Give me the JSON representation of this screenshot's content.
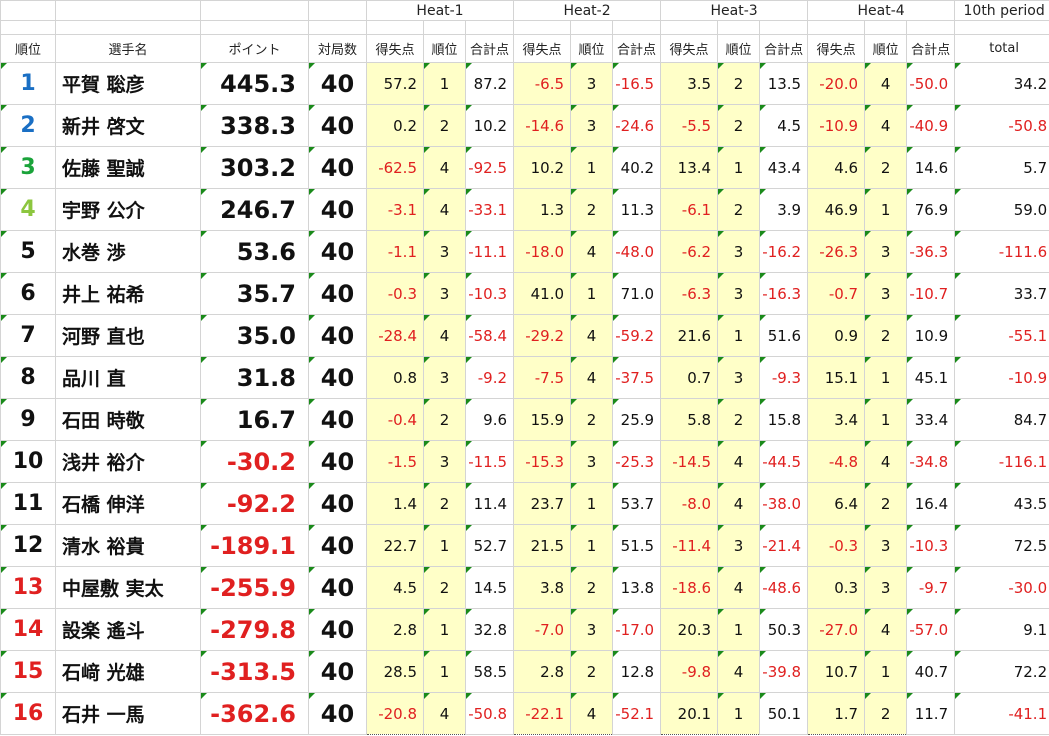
{
  "header": {
    "heats": [
      "Heat-1",
      "Heat-2",
      "Heat-3",
      "Heat-4"
    ],
    "period": "10th period",
    "col_rank": "順位",
    "col_name": "選手名",
    "col_points": "ポイント",
    "col_games": "対局数",
    "col_score": "得失点",
    "col_place": "順位",
    "col_cum": "合計点",
    "col_total": "total"
  },
  "colors": {
    "rank1": "#1a6fc4",
    "rank2": "#1a6fc4",
    "rank3": "#1aa33a",
    "rank4": "#8cc63f",
    "default": "#111111",
    "negative": "#e02020",
    "highlight": "#ffffc8"
  },
  "rows": [
    {
      "rank": "1",
      "name": "平賀 聡彦",
      "points": "445.3",
      "games": "40",
      "h": [
        [
          "57.2",
          "1",
          "87.2"
        ],
        [
          "-6.5",
          "3",
          "-16.5"
        ],
        [
          "3.5",
          "2",
          "13.5"
        ],
        [
          "-20.0",
          "4",
          "-50.0"
        ]
      ],
      "total": "34.2"
    },
    {
      "rank": "2",
      "name": "新井 啓文",
      "points": "338.3",
      "games": "40",
      "h": [
        [
          "0.2",
          "2",
          "10.2"
        ],
        [
          "-14.6",
          "3",
          "-24.6"
        ],
        [
          "-5.5",
          "2",
          "4.5"
        ],
        [
          "-10.9",
          "4",
          "-40.9"
        ]
      ],
      "total": "-50.8"
    },
    {
      "rank": "3",
      "name": "佐藤 聖誠",
      "points": "303.2",
      "games": "40",
      "h": [
        [
          "-62.5",
          "4",
          "-92.5"
        ],
        [
          "10.2",
          "1",
          "40.2"
        ],
        [
          "13.4",
          "1",
          "43.4"
        ],
        [
          "4.6",
          "2",
          "14.6"
        ]
      ],
      "total": "5.7"
    },
    {
      "rank": "4",
      "name": "宇野 公介",
      "points": "246.7",
      "games": "40",
      "h": [
        [
          "-3.1",
          "4",
          "-33.1"
        ],
        [
          "1.3",
          "2",
          "11.3"
        ],
        [
          "-6.1",
          "2",
          "3.9"
        ],
        [
          "46.9",
          "1",
          "76.9"
        ]
      ],
      "total": "59.0"
    },
    {
      "rank": "5",
      "name": "水巻 渉",
      "points": "53.6",
      "games": "40",
      "h": [
        [
          "-1.1",
          "3",
          "-11.1"
        ],
        [
          "-18.0",
          "4",
          "-48.0"
        ],
        [
          "-6.2",
          "3",
          "-16.2"
        ],
        [
          "-26.3",
          "3",
          "-36.3"
        ]
      ],
      "total": "-111.6"
    },
    {
      "rank": "6",
      "name": "井上 祐希",
      "points": "35.7",
      "games": "40",
      "h": [
        [
          "-0.3",
          "3",
          "-10.3"
        ],
        [
          "41.0",
          "1",
          "71.0"
        ],
        [
          "-6.3",
          "3",
          "-16.3"
        ],
        [
          "-0.7",
          "3",
          "-10.7"
        ]
      ],
      "total": "33.7"
    },
    {
      "rank": "7",
      "name": "河野 直也",
      "points": "35.0",
      "games": "40",
      "h": [
        [
          "-28.4",
          "4",
          "-58.4"
        ],
        [
          "-29.2",
          "4",
          "-59.2"
        ],
        [
          "21.6",
          "1",
          "51.6"
        ],
        [
          "0.9",
          "2",
          "10.9"
        ]
      ],
      "total": "-55.1"
    },
    {
      "rank": "8",
      "name": "品川 直",
      "points": "31.8",
      "games": "40",
      "h": [
        [
          "0.8",
          "3",
          "-9.2"
        ],
        [
          "-7.5",
          "4",
          "-37.5"
        ],
        [
          "0.7",
          "3",
          "-9.3"
        ],
        [
          "15.1",
          "1",
          "45.1"
        ]
      ],
      "total": "-10.9"
    },
    {
      "rank": "9",
      "name": "石田 時敬",
      "points": "16.7",
      "games": "40",
      "h": [
        [
          "-0.4",
          "2",
          "9.6"
        ],
        [
          "15.9",
          "2",
          "25.9"
        ],
        [
          "5.8",
          "2",
          "15.8"
        ],
        [
          "3.4",
          "1",
          "33.4"
        ]
      ],
      "total": "84.7"
    },
    {
      "rank": "10",
      "name": "浅井 裕介",
      "points": "-30.2",
      "games": "40",
      "h": [
        [
          "-1.5",
          "3",
          "-11.5"
        ],
        [
          "-15.3",
          "3",
          "-25.3"
        ],
        [
          "-14.5",
          "4",
          "-44.5"
        ],
        [
          "-4.8",
          "4",
          "-34.8"
        ]
      ],
      "total": "-116.1"
    },
    {
      "rank": "11",
      "name": "石橋 伸洋",
      "points": "-92.2",
      "games": "40",
      "h": [
        [
          "1.4",
          "2",
          "11.4"
        ],
        [
          "23.7",
          "1",
          "53.7"
        ],
        [
          "-8.0",
          "4",
          "-38.0"
        ],
        [
          "6.4",
          "2",
          "16.4"
        ]
      ],
      "total": "43.5"
    },
    {
      "rank": "12",
      "name": "清水 裕貴",
      "points": "-189.1",
      "games": "40",
      "h": [
        [
          "22.7",
          "1",
          "52.7"
        ],
        [
          "21.5",
          "1",
          "51.5"
        ],
        [
          "-11.4",
          "3",
          "-21.4"
        ],
        [
          "-0.3",
          "3",
          "-10.3"
        ]
      ],
      "total": "72.5"
    },
    {
      "rank": "13",
      "name": "中屋敷 実太",
      "points": "-255.9",
      "games": "40",
      "h": [
        [
          "4.5",
          "2",
          "14.5"
        ],
        [
          "3.8",
          "2",
          "13.8"
        ],
        [
          "-18.6",
          "4",
          "-48.6"
        ],
        [
          "0.3",
          "3",
          "-9.7"
        ]
      ],
      "total": "-30.0"
    },
    {
      "rank": "14",
      "name": "設楽 遙斗",
      "points": "-279.8",
      "games": "40",
      "h": [
        [
          "2.8",
          "1",
          "32.8"
        ],
        [
          "-7.0",
          "3",
          "-17.0"
        ],
        [
          "20.3",
          "1",
          "50.3"
        ],
        [
          "-27.0",
          "4",
          "-57.0"
        ]
      ],
      "total": "9.1"
    },
    {
      "rank": "15",
      "name": "石﨑 光雄",
      "points": "-313.5",
      "games": "40",
      "h": [
        [
          "28.5",
          "1",
          "58.5"
        ],
        [
          "2.8",
          "2",
          "12.8"
        ],
        [
          "-9.8",
          "4",
          "-39.8"
        ],
        [
          "10.7",
          "1",
          "40.7"
        ]
      ],
      "total": "72.2"
    },
    {
      "rank": "16",
      "name": "石井 一馬",
      "points": "-362.6",
      "games": "40",
      "h": [
        [
          "-20.8",
          "4",
          "-50.8"
        ],
        [
          "-22.1",
          "4",
          "-52.1"
        ],
        [
          "20.1",
          "1",
          "50.1"
        ],
        [
          "1.7",
          "2",
          "11.7"
        ]
      ],
      "total": "-41.1"
    }
  ]
}
